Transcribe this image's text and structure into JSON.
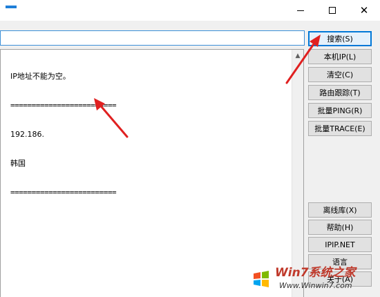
{
  "window": {
    "controls": {
      "minimize": "min-glyph",
      "maximize": "max-glyph",
      "close": "✕"
    }
  },
  "search": {
    "value": "",
    "placeholder": ""
  },
  "output": {
    "lines": [
      "IP地址不能为空。",
      "=========================",
      "192.186.",
      "韩国",
      "========================="
    ]
  },
  "buttons": {
    "search": "搜索(S)",
    "local_ip": "本机IP(L)",
    "clear": "清空(C)",
    "route_trace": "路由跟踪(T)",
    "batch_ping": "批量PING(R)",
    "batch_trace": "批量TRACE(E)",
    "offline_db": "离线库(X)",
    "help": "帮助(H)",
    "ipip_net": "IPIP.NET",
    "language": "语言",
    "about": "关于(A)"
  },
  "watermark": {
    "brand": "Win7系统之家",
    "url": "Www.Winwin7.com"
  },
  "colors": {
    "accent": "#0078d7",
    "arrow": "#e02020"
  }
}
